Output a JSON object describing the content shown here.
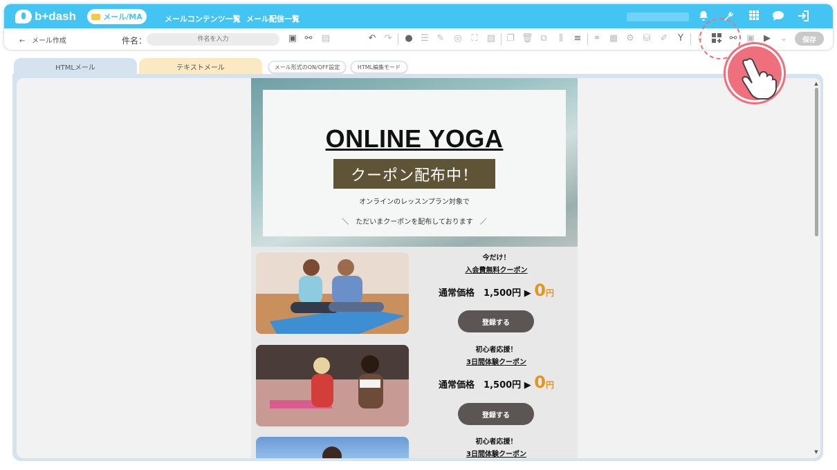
{
  "header": {
    "logo_text": "b+dash",
    "nav_pill": "メール/MA",
    "nav_links": [
      "メールコンテンツ一覧",
      "メール配信一覧"
    ],
    "icons": [
      "bell-icon",
      "wrench-icon",
      "grid-icon",
      "chat-icon",
      "logout-icon"
    ]
  },
  "toolbar": {
    "back_label": "メール作成",
    "subject_label": "件名：",
    "subject_placeholder": "件名を入力",
    "save_label": "保存"
  },
  "tabs": {
    "html": "HTMLメール",
    "text": "テキストメール",
    "toggle": "メール形式のON/OFF設定",
    "html_edit": "HTML編集モード"
  },
  "email": {
    "hero_title": "ONLINE YOGA",
    "hero_badge": "クーポン配布中！",
    "hero_sub": "オンラインのレッスンプラン対象で",
    "hero_sub2": "＼　ただいまクーポンを配布しております　／",
    "promos": [
      {
        "lead": "今だけ！",
        "title": "入会費無料クーポン",
        "price_label": "通常価格　1,500円 ▶",
        "price_value": "0",
        "price_unit": "円",
        "button": "登録する"
      },
      {
        "lead": "初心者応援！",
        "title": "3日間体験クーポン",
        "price_label": "通常価格　1,500円 ▶",
        "price_value": "0",
        "price_unit": "円",
        "button": "登録する"
      },
      {
        "lead": "初心者応援！",
        "title": "3日間体験クーポン"
      }
    ]
  }
}
